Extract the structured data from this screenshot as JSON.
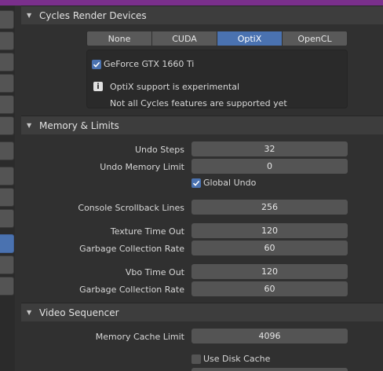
{
  "colors": {
    "accent": "#4a72b0",
    "topbar": "#7a2f8c",
    "background": "#303030",
    "field": "#545454"
  },
  "cycles": {
    "header": "Cycles Render Devices",
    "options": [
      "None",
      "CUDA",
      "OptiX",
      "OpenCL"
    ],
    "selected": "OptiX",
    "device": {
      "name": "GeForce GTX 1660 Ti",
      "checked": true
    },
    "info_icon": "info-icon",
    "message1": "OptiX support is experimental",
    "message2": "Not all Cycles features are supported yet"
  },
  "memory": {
    "header": "Memory & Limits",
    "undo_steps_label": "Undo Steps",
    "undo_steps": "32",
    "undo_memory_label": "Undo Memory Limit",
    "undo_memory": "0",
    "global_undo_label": "Global Undo",
    "global_undo": true,
    "console_label": "Console Scrollback Lines",
    "console": "256",
    "texture_timeout_label": "Texture Time Out",
    "texture_timeout": "120",
    "gc_rate_label_1": "Garbage Collection Rate",
    "gc_rate_1": "60",
    "vbo_timeout_label": "Vbo Time Out",
    "vbo_timeout": "120",
    "gc_rate_label_2": "Garbage Collection Rate",
    "gc_rate_2": "60"
  },
  "sequencer": {
    "header": "Video Sequencer",
    "cache_limit_label": "Memory Cache Limit",
    "cache_limit": "4096",
    "disk_cache_label": "Use Disk Cache",
    "disk_cache": false
  }
}
